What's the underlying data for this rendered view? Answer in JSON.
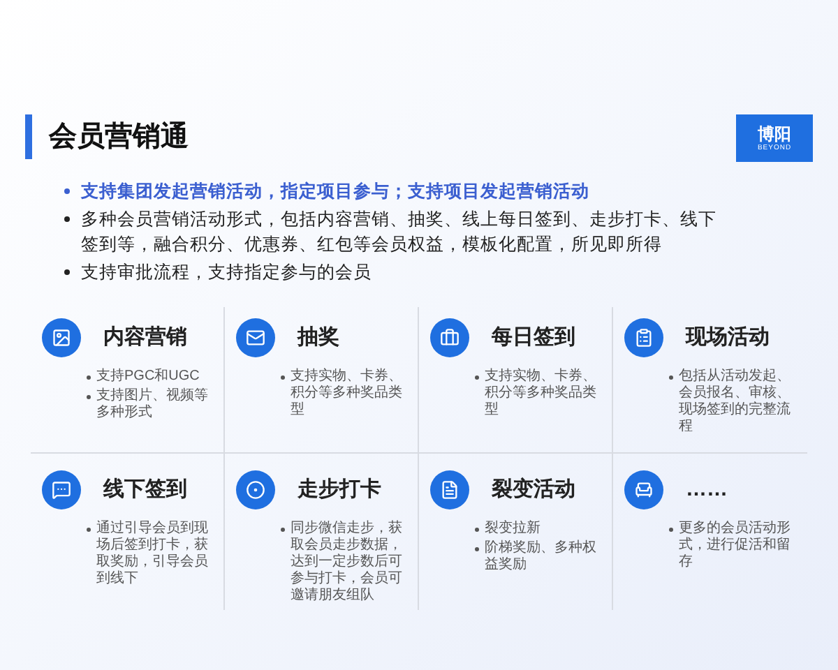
{
  "title": "会员营销通",
  "logo": {
    "name": "博阳",
    "subtitle": "BEYOND"
  },
  "bullets": [
    {
      "text": "支持集团发起营销活动，指定项目参与；支持项目发起营销活动",
      "highlighted": true
    },
    {
      "text": "多种会员营销活动形式，包括内容营销、抽奖、线上每日签到、走步打卡、线下签到等，融合积分、优惠券、红包等会员权益，模板化配置，所见即所得",
      "highlighted": false
    },
    {
      "text": "支持审批流程，支持指定参与的会员",
      "highlighted": false
    }
  ],
  "features": [
    {
      "kind": "image",
      "title": "内容营销",
      "points": [
        "支持PGC和UGC",
        "支持图片、视频等多种形式"
      ]
    },
    {
      "kind": "mail",
      "title": "抽奖",
      "points": [
        "支持实物、卡券、积分等多种奖品类型"
      ]
    },
    {
      "kind": "briefcase",
      "title": "每日签到",
      "points": [
        "支持实物、卡券、积分等多种奖品类型"
      ]
    },
    {
      "kind": "clipboard",
      "title": "现场活动",
      "points": [
        "包括从活动发起、会员报名、审核、现场签到的完整流程"
      ]
    },
    {
      "kind": "chat",
      "title": "线下签到",
      "points": [
        "通过引导会员到现场后签到打卡，获取奖励，引导会员到线下"
      ]
    },
    {
      "kind": "target",
      "title": "走步打卡",
      "points": [
        "同步微信走步，获取会员走步数据，达到一定步数后可参与打卡，会员可邀请朋友组队"
      ]
    },
    {
      "kind": "file",
      "title": "裂变活动",
      "points": [
        "裂变拉新",
        "阶梯奖励、多种权益奖励"
      ]
    },
    {
      "kind": "sofa",
      "title": "……",
      "points": [
        "更多的会员活动形式，进行促活和留存"
      ]
    }
  ]
}
